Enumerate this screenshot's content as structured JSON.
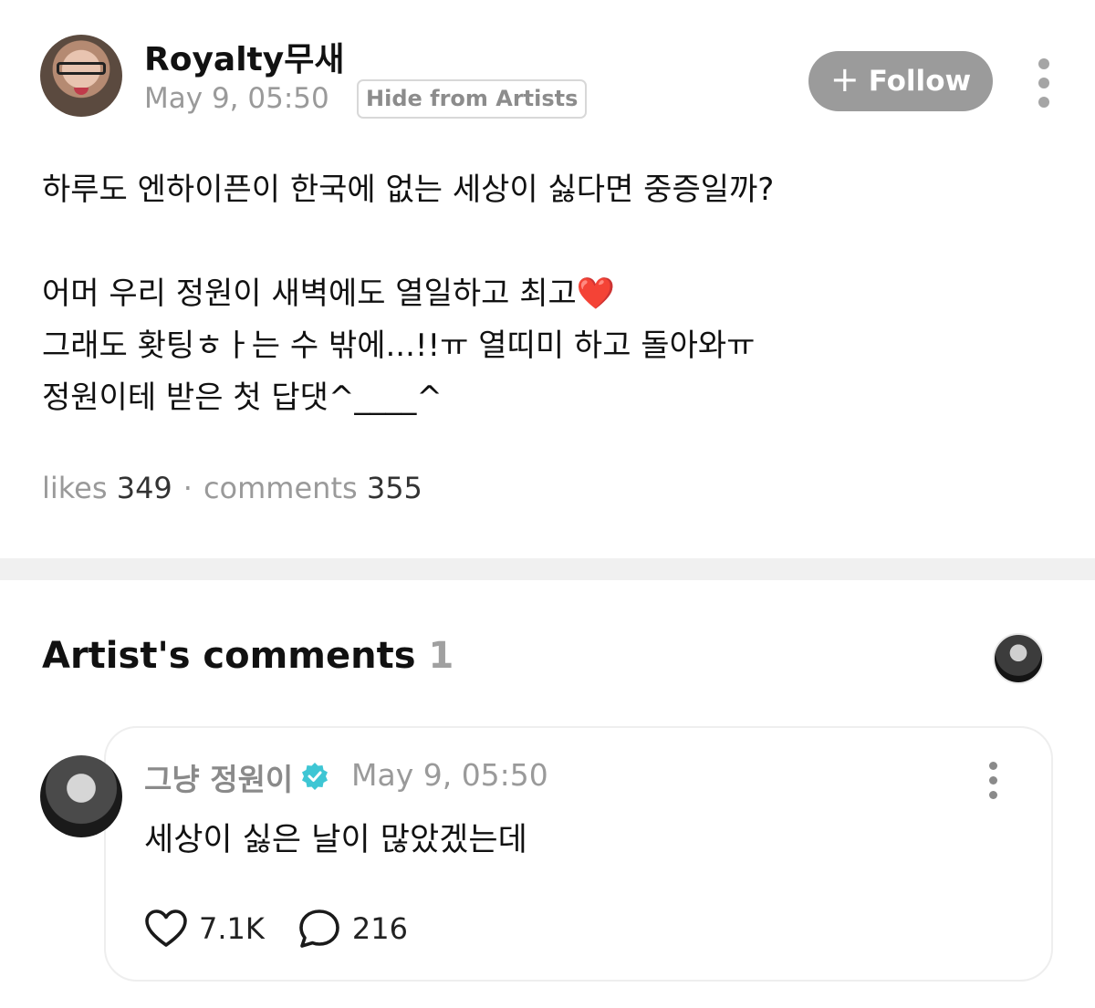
{
  "post": {
    "author": "Royalty무새",
    "time": "May 9, 05:50",
    "hide_badge": "Hide from Artists",
    "follow_label": "Follow",
    "body_lines": [
      "하루도 엔하이픈이 한국에 없는 세상이 싫다면 중증일까?",
      "",
      "어머 우리 정원이 새벽에도 열일하고 최고",
      "그래도 홧팅ㅎㅏ는 수 밖에...!!ㅠ 열띠미 하고 돌아와ㅠ",
      "정원이테 받은 첫 답댓^____^"
    ],
    "heart_emoji": "❤️",
    "likes_label": "likes",
    "likes_count": "349",
    "separator": "·",
    "comments_label": "comments",
    "comments_count": "355"
  },
  "artist_comments": {
    "title": "Artist's comments",
    "count": "1"
  },
  "comment": {
    "author": "그냥 정원이",
    "time": "May 9, 05:50",
    "text": "세상이 싫은 날이 많았겠는데",
    "likes": "7.1K",
    "replies": "216"
  },
  "icons": {
    "follow": "plus-icon",
    "more": "more-vertical-icon",
    "verified": "verified-badge-icon",
    "like": "heart-icon",
    "reply": "comment-bubble-icon"
  },
  "colors": {
    "follow_bg": "#9b9b9b",
    "verified": "#3ec6d4",
    "heart": "#e0202e",
    "muted_text": "#9a9a9a"
  }
}
